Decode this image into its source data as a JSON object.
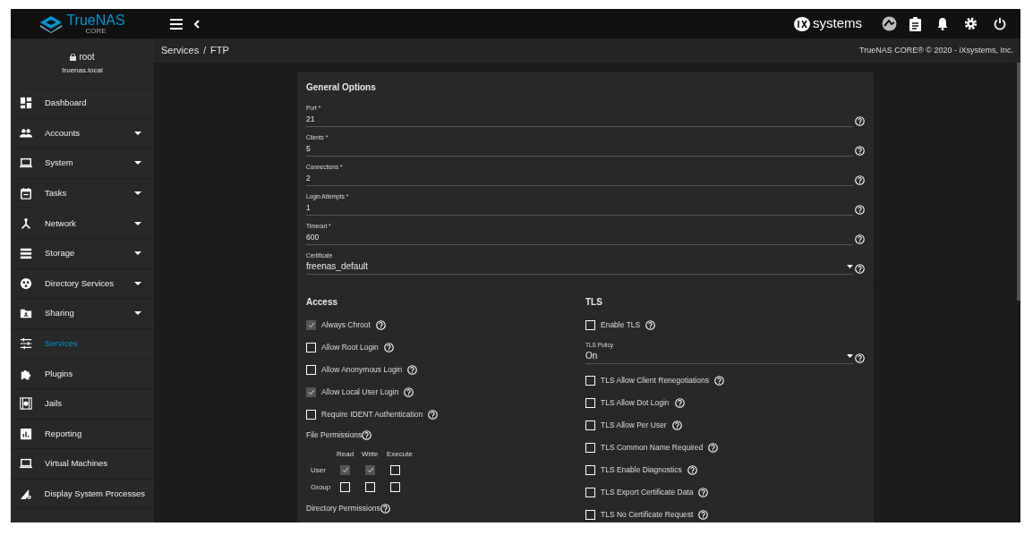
{
  "topbar": {
    "logo": "TrueNAS",
    "logo_sub": "CORE",
    "vendor": "systems"
  },
  "user": {
    "name": "root",
    "host": "truenas.local"
  },
  "sidebar": {
    "items": [
      {
        "label": "Dashboard",
        "expandable": false,
        "selected": false
      },
      {
        "label": "Accounts",
        "expandable": true,
        "selected": false
      },
      {
        "label": "System",
        "expandable": true,
        "selected": false
      },
      {
        "label": "Tasks",
        "expandable": true,
        "selected": false
      },
      {
        "label": "Network",
        "expandable": true,
        "selected": false
      },
      {
        "label": "Storage",
        "expandable": true,
        "selected": false
      },
      {
        "label": "Directory Services",
        "expandable": true,
        "selected": false
      },
      {
        "label": "Sharing",
        "expandable": true,
        "selected": false
      },
      {
        "label": "Services",
        "expandable": false,
        "selected": true
      },
      {
        "label": "Plugins",
        "expandable": false,
        "selected": false
      },
      {
        "label": "Jails",
        "expandable": false,
        "selected": false
      },
      {
        "label": "Reporting",
        "expandable": false,
        "selected": false
      },
      {
        "label": "Virtual Machines",
        "expandable": false,
        "selected": false
      },
      {
        "label": "Display System Processes",
        "expandable": false,
        "selected": false
      }
    ]
  },
  "breadcrumb": [
    "Services",
    "FTP"
  ],
  "breadcrumb_separator": "/",
  "copyright": "TrueNAS CORE® © 2020 - iXsystems, Inc.",
  "general": {
    "title": "General Options",
    "fields": [
      {
        "kind": "input",
        "label": "Port *",
        "value": "21"
      },
      {
        "kind": "input",
        "label": "Clients *",
        "value": "5"
      },
      {
        "kind": "input",
        "label": "Connections *",
        "value": "2"
      },
      {
        "kind": "input",
        "label": "Login Attempts *",
        "value": "1"
      },
      {
        "kind": "input",
        "label": "Timeout *",
        "value": "600"
      },
      {
        "kind": "select",
        "label": "Certificate",
        "value": "freenas_default"
      }
    ]
  },
  "access": {
    "title": "Access",
    "options": [
      {
        "label": "Always Chroot",
        "checked": true
      },
      {
        "label": "Allow Root Login",
        "checked": false
      },
      {
        "label": "Allow Anonymous Login",
        "checked": false
      },
      {
        "label": "Allow Local User Login",
        "checked": true
      },
      {
        "label": "Require IDENT Authentication",
        "checked": false
      }
    ],
    "file_permissions": {
      "label": "File Permissions",
      "columns": [
        "Read",
        "Write",
        "Execute"
      ],
      "rows": [
        {
          "label": "User",
          "checks": [
            true,
            true,
            false
          ]
        },
        {
          "label": "Group",
          "checks": [
            false,
            false,
            false
          ]
        }
      ]
    },
    "directory_permissions": "Directory Permissions"
  },
  "tls": {
    "title": "TLS",
    "items": [
      {
        "kind": "checkbox",
        "label": "Enable TLS",
        "checked": false
      },
      {
        "kind": "select",
        "label": "TLS Policy",
        "value": "On"
      },
      {
        "kind": "checkbox",
        "label": "TLS Allow Client Renegotiations",
        "checked": false
      },
      {
        "kind": "checkbox",
        "label": "TLS Allow Dot Login",
        "checked": false
      },
      {
        "kind": "checkbox",
        "label": "TLS Allow Per User",
        "checked": false
      },
      {
        "kind": "checkbox",
        "label": "TLS Common Name Required",
        "checked": false
      },
      {
        "kind": "checkbox",
        "label": "TLS Enable Diagnostics",
        "checked": false
      },
      {
        "kind": "checkbox",
        "label": "TLS Export Certificate Data",
        "checked": false
      },
      {
        "kind": "checkbox",
        "label": "TLS No Certificate Request",
        "checked": false
      }
    ]
  }
}
